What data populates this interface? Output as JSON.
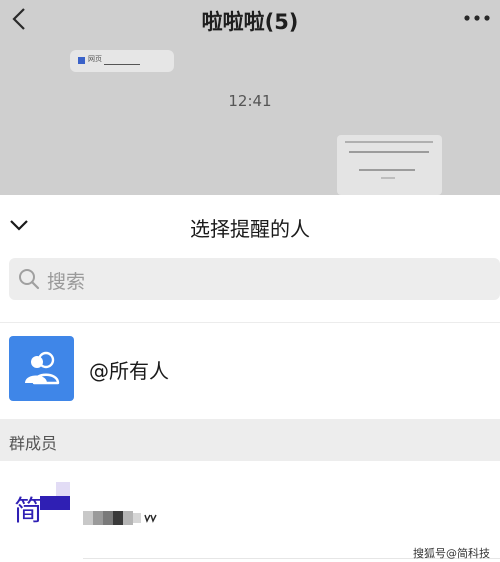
{
  "chat": {
    "title": "啦啦啦(5)",
    "timestamp": "12:41",
    "shared_message_label": "网页"
  },
  "sheet": {
    "title": "选择提醒的人",
    "search_placeholder": "搜索",
    "mention_all_label": "@所有人",
    "section_title": "群成员",
    "members": [
      {
        "avatar_text": "简"
      }
    ]
  },
  "watermark": "搜狐号@简科技",
  "colors": {
    "accent_blue": "#3f86e8",
    "dim_overlay": "#cfcfcf",
    "section_bg": "#ededed"
  }
}
